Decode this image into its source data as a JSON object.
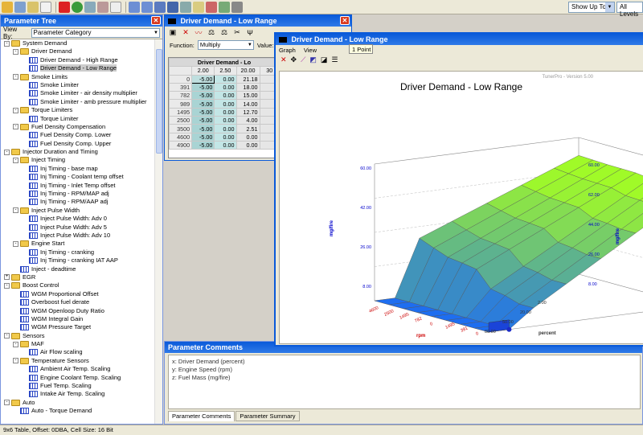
{
  "toolbar": {
    "show_up_to": "Show Up To",
    "levels": "All Levels"
  },
  "tree_panel": {
    "title": "Parameter Tree",
    "view_by_label": "View By:",
    "view_by_value": "Parameter Category",
    "nodes": [
      {
        "label": "System Demand",
        "depth": 0,
        "kind": "folder",
        "exp": "-"
      },
      {
        "label": "Driver Demand",
        "depth": 1,
        "kind": "folder",
        "exp": "-"
      },
      {
        "label": "Driver Demand - High Range",
        "depth": 2,
        "kind": "grid"
      },
      {
        "label": "Driver Demand - Low Range",
        "depth": 2,
        "kind": "grid",
        "selected": true
      },
      {
        "label": "Smoke Limits",
        "depth": 1,
        "kind": "folder",
        "exp": "-"
      },
      {
        "label": "Smoke Limiter",
        "depth": 2,
        "kind": "grid"
      },
      {
        "label": "Smoke Limiter - air density multiplier",
        "depth": 2,
        "kind": "grid"
      },
      {
        "label": "Smoke Limiter - amb pressure multiplier",
        "depth": 2,
        "kind": "grid"
      },
      {
        "label": "Torque Limiters",
        "depth": 1,
        "kind": "folder",
        "exp": "-"
      },
      {
        "label": "Torque Limiter",
        "depth": 2,
        "kind": "grid"
      },
      {
        "label": "Fuel Density Compensation",
        "depth": 1,
        "kind": "folder",
        "exp": "-"
      },
      {
        "label": "Fuel Density Comp. Lower",
        "depth": 2,
        "kind": "grid"
      },
      {
        "label": "Fuel Density Comp. Upper",
        "depth": 2,
        "kind": "grid"
      },
      {
        "label": "Injector Duration and Timing",
        "depth": 0,
        "kind": "folder",
        "exp": "-"
      },
      {
        "label": "Inject Timing",
        "depth": 1,
        "kind": "folder",
        "exp": "-"
      },
      {
        "label": "Inj Timing - base map",
        "depth": 2,
        "kind": "grid"
      },
      {
        "label": "Inj Timing - Coolant temp offset",
        "depth": 2,
        "kind": "grid"
      },
      {
        "label": "Inj Timing - Inlet Temp offset",
        "depth": 2,
        "kind": "grid"
      },
      {
        "label": "Inj Timing - RPM/MAP adj",
        "depth": 2,
        "kind": "grid"
      },
      {
        "label": "Inj Timing - RPM/AAP adj",
        "depth": 2,
        "kind": "grid"
      },
      {
        "label": "Inject Pulse Width",
        "depth": 1,
        "kind": "folder",
        "exp": "-"
      },
      {
        "label": "Inject Pulse Width: Adv 0",
        "depth": 2,
        "kind": "grid"
      },
      {
        "label": "Inject Pulse Width: Adv 5",
        "depth": 2,
        "kind": "grid"
      },
      {
        "label": "Inject Pulse Width: Adv 10",
        "depth": 2,
        "kind": "grid"
      },
      {
        "label": "Engine Start",
        "depth": 1,
        "kind": "folder",
        "exp": "-"
      },
      {
        "label": "Inj Timing - cranking",
        "depth": 2,
        "kind": "grid"
      },
      {
        "label": "Inj Timing - cranking IAT AAP",
        "depth": 2,
        "kind": "grid"
      },
      {
        "label": "Inject - deadtime",
        "depth": 1,
        "kind": "grid"
      },
      {
        "label": "EGR",
        "depth": 0,
        "kind": "folder",
        "exp": "+"
      },
      {
        "label": "Boost Control",
        "depth": 0,
        "kind": "folder",
        "exp": "-"
      },
      {
        "label": "WGM Proportional Offset",
        "depth": 1,
        "kind": "grid"
      },
      {
        "label": "Overboost fuel derate",
        "depth": 1,
        "kind": "grid"
      },
      {
        "label": "WGM Openloop Duty Ratio",
        "depth": 1,
        "kind": "grid"
      },
      {
        "label": "WGM Integral Gain",
        "depth": 1,
        "kind": "grid"
      },
      {
        "label": "WGM Pressure Target",
        "depth": 1,
        "kind": "grid"
      },
      {
        "label": "Sensors",
        "depth": 0,
        "kind": "folder",
        "exp": "-"
      },
      {
        "label": "MAF",
        "depth": 1,
        "kind": "folder",
        "exp": "-"
      },
      {
        "label": "Air Flow  scaling",
        "depth": 2,
        "kind": "grid"
      },
      {
        "label": "Temperature Sensors",
        "depth": 1,
        "kind": "folder",
        "exp": "-"
      },
      {
        "label": "Ambient Air Temp. Scaling",
        "depth": 2,
        "kind": "grid"
      },
      {
        "label": "Engine Coolant Temp. Scaling",
        "depth": 2,
        "kind": "grid"
      },
      {
        "label": "Fuel Temp. Scaling",
        "depth": 2,
        "kind": "grid"
      },
      {
        "label": "Intake Air Temp. Scaling",
        "depth": 2,
        "kind": "grid"
      },
      {
        "label": "Auto",
        "depth": 0,
        "kind": "folder",
        "exp": "-"
      },
      {
        "label": "Auto - Torque Demand",
        "depth": 1,
        "kind": "grid"
      }
    ]
  },
  "status_bar": "9x6 Table, Offset: 0DBA,  Cell Size: 16 Bit",
  "table_window": {
    "title": "Driver Demand - Low Range",
    "function_label": "Function:",
    "function_value": "Multiply",
    "value_label": "Value:",
    "table_title": "Driver Demand - Lo",
    "col_headers": [
      "2.00",
      "2.50",
      "20.00",
      "30"
    ],
    "rows": [
      {
        "rpm": "0",
        "cells": [
          "-5.00",
          "0.00",
          "21.18"
        ]
      },
      {
        "rpm": "391",
        "cells": [
          "-5.00",
          "0.00",
          "18.00"
        ]
      },
      {
        "rpm": "782",
        "cells": [
          "-5.00",
          "0.00",
          "15.00"
        ]
      },
      {
        "rpm": "989",
        "cells": [
          "-5.00",
          "0.00",
          "14.00"
        ]
      },
      {
        "rpm": "1495",
        "cells": [
          "-5.00",
          "0.00",
          "12.70"
        ]
      },
      {
        "rpm": "2500",
        "cells": [
          "-5.00",
          "0.00",
          "4.00"
        ]
      },
      {
        "rpm": "3500",
        "cells": [
          "-5.00",
          "0.00",
          "2.51"
        ]
      },
      {
        "rpm": "4600",
        "cells": [
          "-5.00",
          "0.00",
          "0.00"
        ]
      },
      {
        "rpm": "4900",
        "cells": [
          "-5.00",
          "0.00",
          "0.00"
        ]
      }
    ]
  },
  "comments": {
    "title": "Parameter Comments",
    "lines": [
      "x: Driver Demand (percent)",
      "y: Engine Speed (rpm)",
      "z: Fuel Mass (mg/fire)"
    ],
    "tabs": [
      "Parameter Comments",
      "Parameter Summary"
    ]
  },
  "graph_window": {
    "title": "Driver Demand - Low Range",
    "menu": [
      "Graph",
      "View"
    ],
    "watermark": "TunerPro - Version 5.00",
    "chart_title": "Driver Demand - Low Range",
    "tooltip": "1 Point",
    "z_axis_label": "mg/fire",
    "x_axis_label": "percent",
    "y_axis_label": "rpm",
    "z_ticks_left": [
      "60.00",
      "42.00",
      "26.00",
      "8.00"
    ],
    "z_ticks_right": [
      "60.00",
      "62.00",
      "44.00",
      "26.00",
      "8.00"
    ],
    "rpm_ticks": [
      "4600",
      "2500",
      "1495",
      "782",
      "0",
      "1495",
      "391",
      "0"
    ],
    "percent_ticks": [
      "2.00",
      "20.00",
      "50.00",
      "80.00"
    ]
  },
  "chart_data": {
    "type": "surface",
    "title": "Driver Demand - Low Range",
    "x_label": "percent",
    "y_label": "rpm",
    "z_label": "mg/fire",
    "x_visible": [
      2.0,
      2.5,
      20.0
    ],
    "y": [
      0,
      391,
      782,
      989,
      1495,
      2500,
      3500,
      4600,
      4900
    ],
    "z_rows": [
      [
        -5.0,
        0.0,
        21.18
      ],
      [
        -5.0,
        0.0,
        18.0
      ],
      [
        -5.0,
        0.0,
        15.0
      ],
      [
        -5.0,
        0.0,
        14.0
      ],
      [
        -5.0,
        0.0,
        12.7
      ],
      [
        -5.0,
        0.0,
        4.0
      ],
      [
        -5.0,
        0.0,
        2.51
      ],
      [
        -5.0,
        0.0,
        0.0
      ],
      [
        -5.0,
        0.0,
        0.0
      ]
    ]
  }
}
